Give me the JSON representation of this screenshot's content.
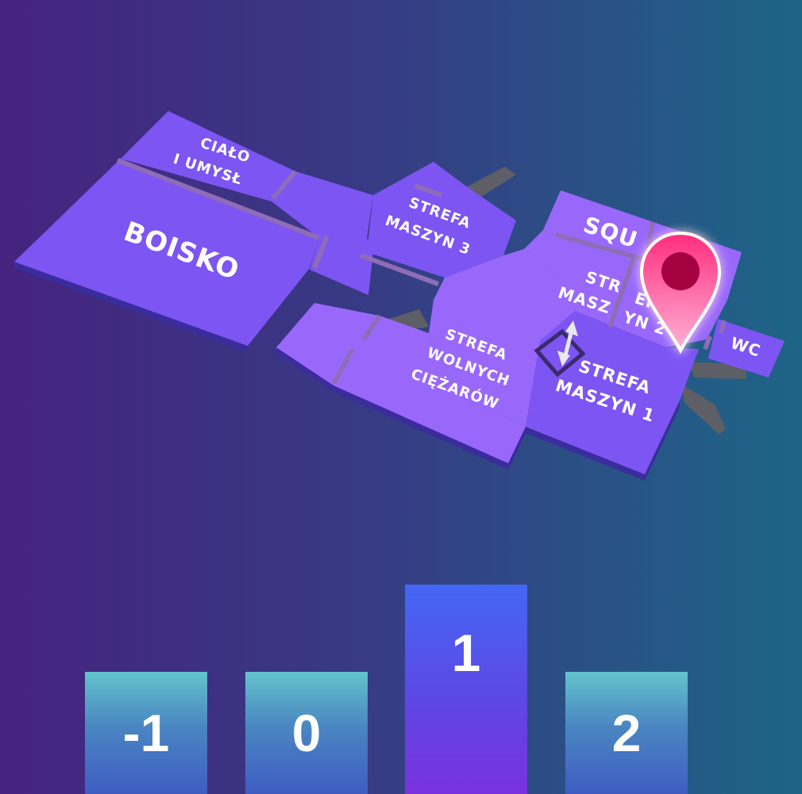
{
  "map": {
    "rooms": [
      {
        "id": "cialo",
        "lines": [
          "CIAŁO",
          "I UMYSŁ"
        ]
      },
      {
        "id": "boisko",
        "lines": [
          "BOISKO"
        ]
      },
      {
        "id": "maszyn3",
        "lines": [
          "STREFA",
          "MASZYN 3"
        ]
      },
      {
        "id": "squash",
        "lines": [
          "SQU"
        ]
      },
      {
        "id": "maszyn2",
        "lines": [
          "STR",
          "MASZ"
        ],
        "lines_b": [
          "EF",
          "YN 2"
        ]
      },
      {
        "id": "wc",
        "lines": [
          "WC"
        ]
      },
      {
        "id": "wolnych",
        "lines": [
          "STREFA",
          "WOLNYCH",
          "CIĘŻARÓW"
        ]
      },
      {
        "id": "maszyn1",
        "lines": [
          "STREFA",
          "MASZYN 1"
        ]
      }
    ],
    "icons": {
      "elevator": "elevator-arrows-icon",
      "pin": "location-pin-icon"
    },
    "pin_color": "#ff2d7d"
  },
  "floors": [
    {
      "label": "-1",
      "active": false
    },
    {
      "label": "0",
      "active": false
    },
    {
      "label": "1",
      "active": true
    },
    {
      "label": "2",
      "active": false
    }
  ]
}
